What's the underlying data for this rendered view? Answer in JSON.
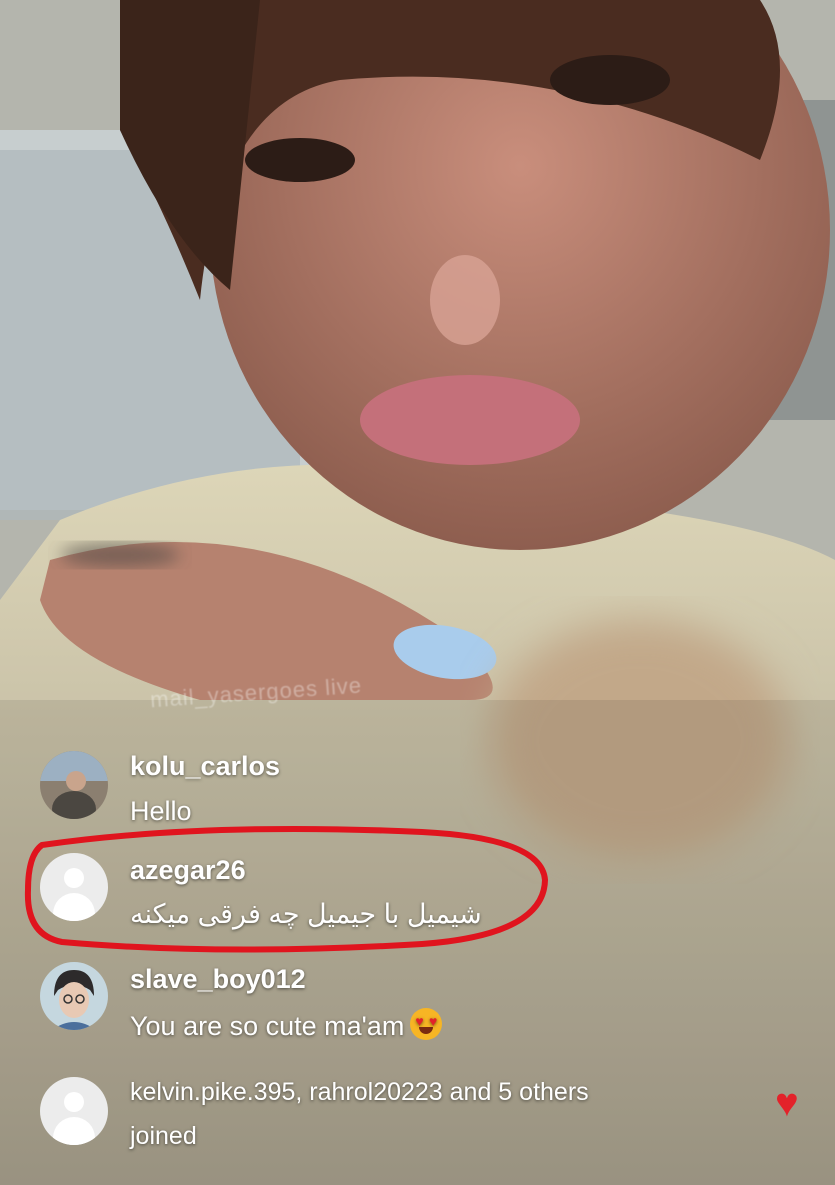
{
  "watermark": "mail_yasergoes live",
  "comments": [
    {
      "username": "kolu_carlos",
      "message": "Hello"
    },
    {
      "username": "azegar26",
      "message": "شیمیل با جیمیل چه فرقی میکنه"
    },
    {
      "username": "slave_boy012",
      "message": "You are so cute ma'am",
      "emoji": "heart-eyes-emoji"
    }
  ],
  "joined": {
    "text": "kelvin.pike.395, rahrol20223 and 5 others joined"
  },
  "colors": {
    "highlight": "#e0141e",
    "heart": "#e3222a"
  },
  "icons": {
    "like": "heart-icon",
    "avatar_placeholder": "default-avatar-icon"
  }
}
